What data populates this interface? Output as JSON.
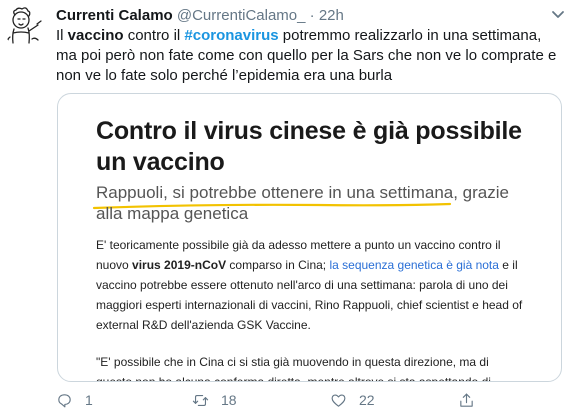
{
  "tweet": {
    "display_name": "Currenti Calamo",
    "handle": "@CurrentiCalamo_",
    "separator": "·",
    "time": "22h",
    "text": {
      "part1": "Il ",
      "bold1": "vaccino",
      "part2": " contro il ",
      "hashtag": "#coronavirus",
      "part3": " potremmo realizzarlo in una settimana, ma poi però non fate come con quello per la Sars che non ve lo comprate e non ve lo fate solo perché l’epidemia era una burla"
    }
  },
  "card": {
    "title": "Contro il virus cinese è già possibile un vaccino",
    "subtitle": "Rappuoli, si potrebbe ottenere in una settimana, grazie alla mappa genetica",
    "para": {
      "p1": "E' teoricamente possibile già da adesso mettere a punto un vaccino contro il nuovo ",
      "bold": "virus 2019-nCoV",
      "p2": " comparso in Cina; ",
      "link": "la sequenza genetica è già nota",
      "p3": " e il vaccino potrebbe essere ottenuto nell'arco di una settimana: parola di uno dei maggiori esperti internazionali di vaccini, Rino Rappuoli, chief scientist e head of external R&D dell'azienda GSK Vaccine."
    },
    "quote": "\"E' possibile che in Cina ci si stia già muovendo in questa direzione, ma di questo non ho alcuna conferma diretta, mentre altrove si sta aspettando di"
  },
  "actions": {
    "reply_count": "1",
    "retweet_count": "18",
    "like_count": "22"
  },
  "icons": {
    "reply": "reply-icon",
    "retweet": "retweet-icon",
    "like": "heart-icon",
    "share": "share-icon",
    "menu": "chevron-down-icon"
  },
  "colors": {
    "hashtag": "#1b95e0",
    "muted": "#657786",
    "underline": "#f2c200"
  }
}
